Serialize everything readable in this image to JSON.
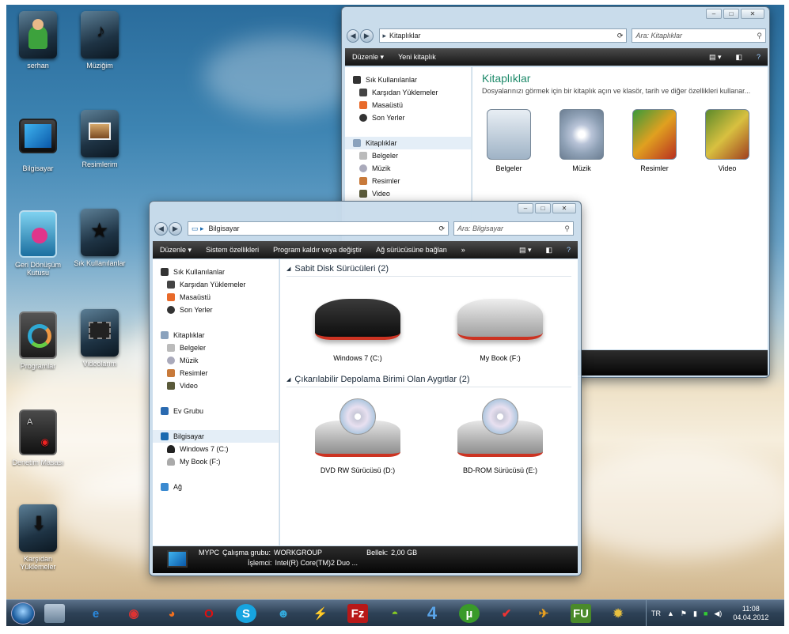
{
  "desktop": {
    "icons": [
      {
        "label": "serhan"
      },
      {
        "label": "Müziğim"
      },
      {
        "label": "Bilgisayar"
      },
      {
        "label": "Resimlerim"
      },
      {
        "label": "Geri Dönüşüm Kutusu"
      },
      {
        "label": "Sık Kullanılanlar"
      },
      {
        "label": "Programlar"
      },
      {
        "label": "Videolarım"
      },
      {
        "label": "Denetim Masası"
      },
      {
        "label": "Karşıdan Yüklemeler"
      }
    ]
  },
  "libwin": {
    "address": "Kitaplıklar",
    "search": "Ara: Kitaplıklar",
    "toolbar": {
      "organize": "Düzenle",
      "new_library": "Yeni kitaplık"
    },
    "nav": {
      "favorites": "Sık Kullanılanlar",
      "downloads": "Karşıdan Yüklemeler",
      "desktop": "Masaüstü",
      "recent": "Son Yerler",
      "libraries": "Kitaplıklar",
      "docs": "Belgeler",
      "music": "Müzik",
      "pictures": "Resimler",
      "video": "Video"
    },
    "title": "Kitaplıklar",
    "subtitle": "Dosyalarınızı görmek için bir kitaplık açın ve klasör, tarih ve diğer özellikleri kullanar...",
    "items": [
      {
        "label": "Belgeler"
      },
      {
        "label": "Müzik"
      },
      {
        "label": "Resimler"
      },
      {
        "label": "Video"
      }
    ]
  },
  "compwin": {
    "address": "Bilgisayar",
    "search": "Ara: Bilgisayar",
    "toolbar": {
      "organize": "Düzenle",
      "system": "Sistem özellikleri",
      "uninstall": "Program kaldır veya değiştir",
      "map": "Ağ sürücüsüne bağlan",
      "more": "»"
    },
    "nav": {
      "favorites": "Sık Kullanılanlar",
      "downloads": "Karşıdan Yüklemeler",
      "desktop": "Masaüstü",
      "recent": "Son Yerler",
      "libraries": "Kitaplıklar",
      "docs": "Belgeler",
      "music": "Müzik",
      "pictures": "Resimler",
      "video": "Video",
      "homegroup": "Ev Grubu",
      "computer": "Bilgisayar",
      "c": "Windows 7 (C:)",
      "f": "My Book (F:)",
      "network": "Ağ"
    },
    "group1": "Sabit Disk Sürücüleri (2)",
    "group2": "Çıkarılabilir Depolama Birimi Olan Aygıtlar (2)",
    "drives": [
      {
        "label": "Windows 7 (C:)"
      },
      {
        "label": "My Book (F:)"
      }
    ],
    "removable": [
      {
        "label": "DVD RW Sürücüsü (D:)"
      },
      {
        "label": "BD-ROM Sürücüsü (E:)"
      }
    ],
    "status": {
      "name": "MYPC",
      "wg_label": "Çalışma grubu:",
      "wg": "WORKGROUP",
      "mem_label": "Bellek:",
      "mem": "2,00 GB",
      "cpu_label": "İşlemci:",
      "cpu": "Intel(R) Core(TM)2 Duo ..."
    }
  },
  "taskbar": {
    "lang": "TR",
    "time": "11:08",
    "date": "04.04.2012"
  }
}
